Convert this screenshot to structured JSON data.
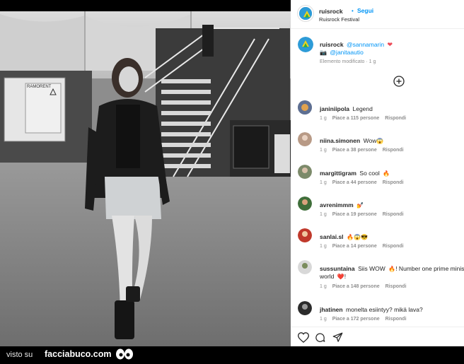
{
  "post": {
    "author": "ruisrock",
    "follow_sep": "•",
    "follow_label": "Segui",
    "location": "Ruisrock Festival",
    "caption_user": "ruisrock",
    "caption_mention1": "@sannamarin",
    "caption_mention2": "@janitaautio",
    "edited": "Elemento modificato · 1 g"
  },
  "comments": [
    {
      "user": "janiniipola",
      "text": "Legend",
      "emoji": "",
      "age": "1 g",
      "likes": "Piace a 115 persone",
      "reply": "Rispondi"
    },
    {
      "user": "niina.simonen",
      "text": "Wow",
      "emoji": "😱",
      "age": "1 g",
      "likes": "Piace a 38 persone",
      "reply": "Rispondi"
    },
    {
      "user": "margittigram",
      "text": "So cool",
      "emoji": "🔥",
      "age": "1 g",
      "likes": "Piace a 44 persone",
      "reply": "Rispondi"
    },
    {
      "user": "avrenimmm",
      "text": "",
      "emoji": "💅",
      "age": "1 g",
      "likes": "Piace a 19 persone",
      "reply": "Rispondi"
    },
    {
      "user": "sanlai.sl",
      "text": "",
      "emoji": "🔥😱😎",
      "age": "1 g",
      "likes": "Piace a 14 persone",
      "reply": "Rispondi"
    },
    {
      "user": "sussuntaina",
      "text": "Siis WOW",
      "emoji": "🔥",
      "text2": "! Number one prime minister in the",
      "text3": "world",
      "emoji2": "❤️",
      "text4": "!",
      "age": "1 g",
      "likes": "Piace a 148 persone",
      "reply": "Rispondi"
    },
    {
      "user": "jhatinen",
      "text": "monelta esiintyy? mikä lava?",
      "emoji": "",
      "age": "1 g",
      "likes": "Piace a 172 persone",
      "reply": "Rispondi"
    }
  ],
  "footer": {
    "visto": "visto su",
    "site": "facciabuco.com"
  },
  "icons": {
    "add": "plus-circle-icon",
    "like": "heart-icon",
    "comment": "comment-icon",
    "share": "send-icon"
  },
  "colors": {
    "accent_blue": "#0095f6",
    "heart_red": "#ed4956"
  }
}
